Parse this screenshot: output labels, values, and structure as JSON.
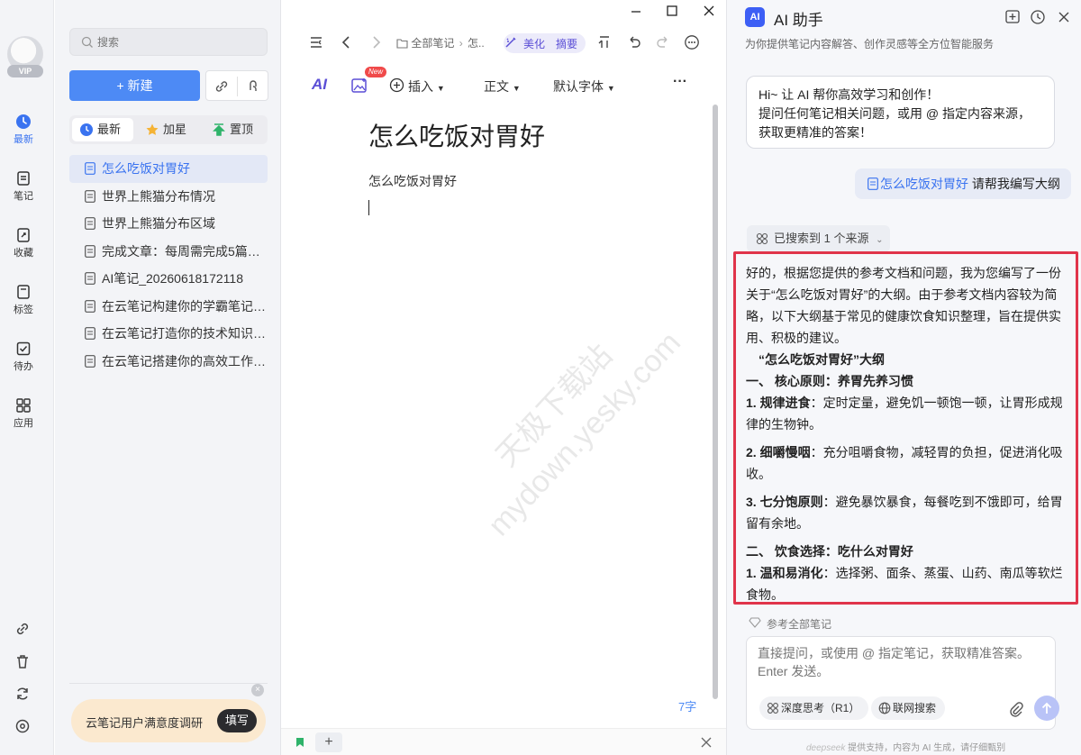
{
  "rail": {
    "vip": "VIP",
    "items": [
      {
        "label": "最新",
        "icon": "clock-icon"
      },
      {
        "label": "笔记",
        "icon": "note-icon"
      },
      {
        "label": "收藏",
        "icon": "bookmark-icon"
      },
      {
        "label": "标签",
        "icon": "tag-icon"
      },
      {
        "label": "待办",
        "icon": "todo-icon"
      },
      {
        "label": "应用",
        "icon": "apps-icon"
      }
    ]
  },
  "list": {
    "search_placeholder": "搜索",
    "new_label": "新建",
    "tabs": [
      "最新",
      "加星",
      "置顶"
    ],
    "notes": [
      "怎么吃饭对胃好",
      "世界上熊猫分布情况",
      "世界上熊猫分布区域",
      "完成文章：每周需完成5篇…",
      "AI笔记_20260618172118",
      "在云笔记构建你的学霸笔记…",
      "在云笔记打造你的技术知识…",
      "在云笔记搭建你的高效工作…"
    ],
    "survey_text": "云笔记用户满意度调研",
    "survey_button": "填写",
    "survey_close": "×"
  },
  "editor": {
    "breadcrumb_root": "全部笔记",
    "breadcrumb_sep": "›",
    "breadcrumb_current": "怎..",
    "chip_beautify": "美化",
    "chip_summary": "摘要",
    "toolbar": {
      "ai": "AI",
      "new_badge": "New",
      "insert": "插入",
      "style": "正文",
      "font": "默认字体",
      "more": "···"
    },
    "title": "怎么吃饭对胃好",
    "body": "怎么吃饭对胃好",
    "word_count": "7字",
    "watermark_line1": "天极下载站",
    "watermark_line2": "mydown.yesky.com"
  },
  "ai": {
    "logo": "AI",
    "title": "AI 助手",
    "subtitle": "为你提供笔记内容解答、创作灵感等全方位智能服务",
    "welcome_l1": "Hi~ 让 AI 帮你高效学习和创作！",
    "welcome_l2": "提问任何笔记相关问题，或用 @ 指定内容来源，",
    "welcome_l3": "获取更精准的答案！",
    "user_ref": "怎么吃饭对胃好",
    "user_text": "请帮我编写大纲",
    "sources": "已搜索到 1 个来源",
    "answer": {
      "intro": "好的，根据您提供的参考文档和问题，我为您编写了一份关于“怎么吃饭对胃好”的大纲。由于参考文档内容较为简略，以下大纲基于常见的健康饮食知识整理，旨在提供实用、积极的建议。",
      "outline_title": "“怎么吃饭对胃好”大纲",
      "section1": "一、 核心原则：养胃先养习惯",
      "p1_head": "1. 规律进食",
      "p1_text": "：定时定量，避免饥一顿饱一顿，让胃形成规律的生物钟。",
      "p2_head": "2. 细嚼慢咽",
      "p2_text": "：充分咀嚼食物，减轻胃的负担，促进消化吸收。",
      "p3_head": "3. 七分饱原则",
      "p3_text": "：避免暴饮暴食，每餐吃到不饿即可，给胃留有余地。",
      "section2": "二、 饮食选择：吃什么对胃好",
      "p4_head": "1. 温和易消化",
      "p4_text": "：选择粥、面条、蒸蛋、山药、南瓜等软烂食物。"
    },
    "ref_all": "参考全部笔记",
    "input_placeholder": "直接提问，或使用 @ 指定笔记，获取精准答案。Enter 发送。",
    "deep_think": "深度思考（R1）",
    "web_search": "联网搜索",
    "footer_brand": "deepseek",
    "footer_text": "提供支持，内容为 AI 生成，请仔细甄别",
    "accent": "#3a73f0",
    "highlight": "#e0344a"
  }
}
